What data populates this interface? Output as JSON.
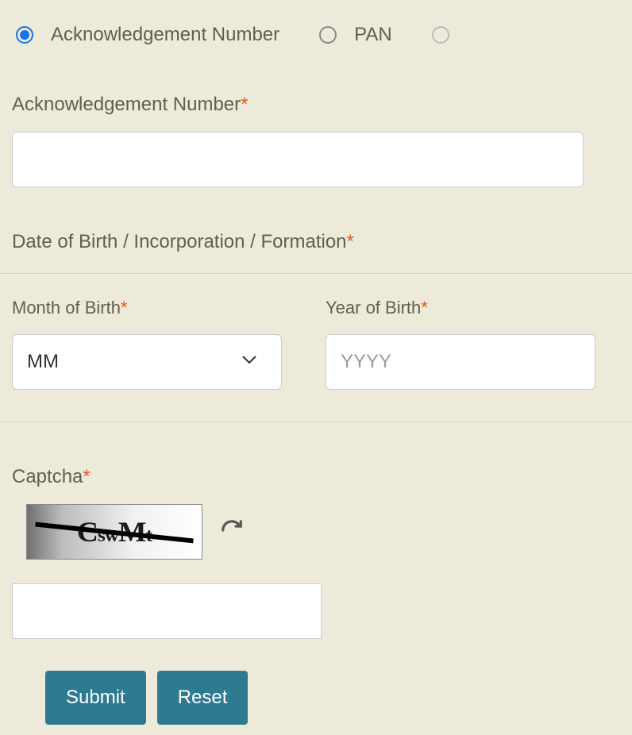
{
  "radios": {
    "option1": "Acknowledgement Number",
    "option2": "PAN",
    "option3": ""
  },
  "ack": {
    "label": "Acknowledgement Number"
  },
  "dob": {
    "label": "Date of Birth / Incorporation / Formation",
    "month_label": "Month of Birth",
    "month_value": "MM",
    "year_label": "Year of Birth",
    "year_placeholder": "YYYY"
  },
  "captcha": {
    "label": "Captcha",
    "text": "CSwMT"
  },
  "buttons": {
    "submit": "Submit",
    "reset": "Reset"
  },
  "required_marker": "*"
}
